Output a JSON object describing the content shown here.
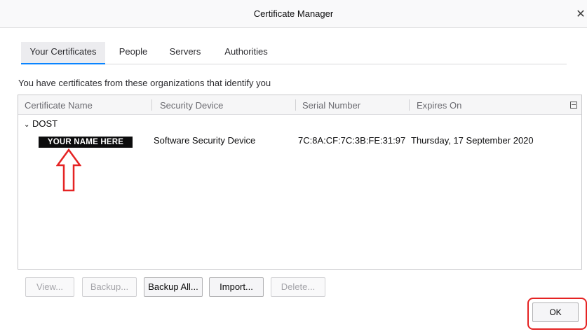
{
  "window": {
    "title": "Certificate Manager",
    "close_glyph": "✕"
  },
  "tabs": [
    {
      "label": "Your Certificates",
      "active": true
    },
    {
      "label": "People",
      "active": false
    },
    {
      "label": "Servers",
      "active": false
    },
    {
      "label": "Authorities",
      "active": false
    }
  ],
  "intro_text": "You have certificates from these organizations that identify you",
  "table": {
    "columns": [
      "Certificate Name",
      "Security Device",
      "Serial Number",
      "Expires On"
    ],
    "groups": [
      {
        "name": "DOST",
        "expanded": true,
        "rows": [
          {
            "certificate_name": "YOUR NAME HERE",
            "security_device": "Software Security Device",
            "serial_number": "7C:8A:CF:7C:3B:FE:31:97",
            "expires_on": "Thursday, 17 September 2020"
          }
        ]
      }
    ]
  },
  "buttons": {
    "view": "View...",
    "backup": "Backup...",
    "backup_all": "Backup All...",
    "import": "Import...",
    "delete": "Delete...",
    "ok": "OK"
  },
  "annotation": {
    "arrow_color": "#e52323",
    "highlight_color": "#e52323"
  },
  "colors": {
    "accent": "#0a84ff"
  }
}
